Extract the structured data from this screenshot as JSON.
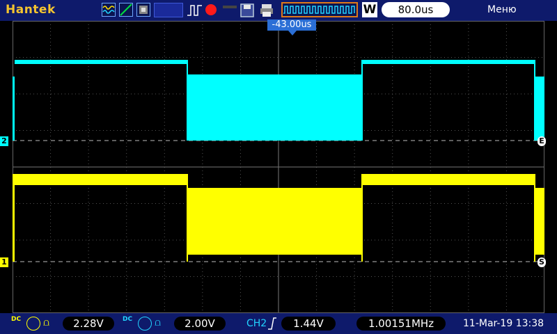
{
  "header": {
    "brand": "Hantek",
    "timebase": "80.0us",
    "timebase_mode": "W",
    "menu_label": "Меню"
  },
  "trigger": {
    "position_label": "-43.00us"
  },
  "channels": {
    "ch1": {
      "color": "#ffff00",
      "marker": "1",
      "coupling": "DC",
      "volts_div": "2.28V"
    },
    "ch2": {
      "color": "#00ffff",
      "marker": "2",
      "coupling": "DC",
      "volts_div": "2.00V"
    }
  },
  "bottom": {
    "trigger_source": "CH2",
    "trigger_level": "1.44V",
    "frequency": "1.00151MHz",
    "date_time": "11-Mar-19 13:38"
  },
  "markers": {
    "edge_marker": "E",
    "slope_marker": "S"
  },
  "icons": [
    "waveform-icon",
    "ramp-icon",
    "persistence-icon",
    "pulse-icon",
    "record-icon",
    "save-icon",
    "print-icon"
  ]
}
